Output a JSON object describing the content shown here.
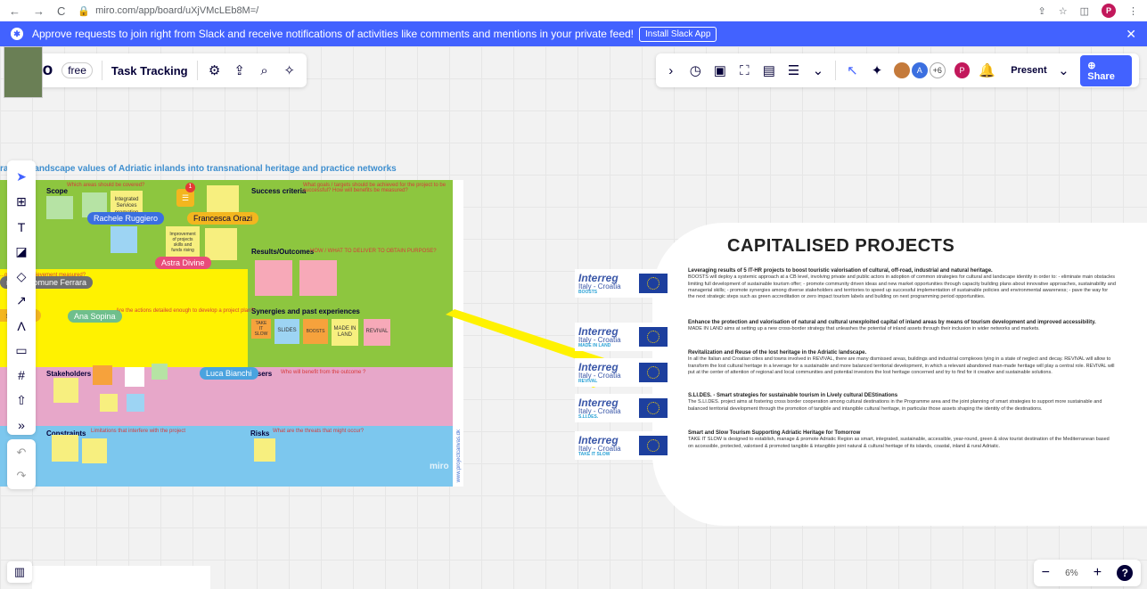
{
  "browser": {
    "back": "←",
    "forward": "→",
    "reload": "C",
    "url": "miro.com/app/board/uXjVMcLEb8M=/",
    "profile_initial": "P"
  },
  "banner": {
    "message": "Approve requests to join right from Slack and receive notifications of activities like comments and mentions in your private feed!",
    "install_label": "Install Slack App",
    "close": "✕"
  },
  "toolbar_left": {
    "logo": "miro",
    "plan": "free",
    "board_name": "Task Tracking"
  },
  "toolbar_right": {
    "extra_count": "+6",
    "present_label": "Present",
    "share_label": "Share",
    "user_initial": "P",
    "avatar_initial": "A"
  },
  "zoom": {
    "minus": "−",
    "level": "6%",
    "plus": "+",
    "help": "?"
  },
  "board": {
    "title": "ral and landscape values of Adriatic inlands into transnational heritage and practice networks",
    "zones": {
      "scope": "Scope",
      "scope_q": "Which areas should be covered?",
      "success": "Success criteria",
      "success_q": "What goals / targets should be achieved for the project to be successful? How will benefits be measured?",
      "results": "Results/Outcomes",
      "results_q": "HOW / WHAT TO DELIVER TO OBTAIN PURPOSE?",
      "achievement_q": "...ow is the achievement measured?",
      "synergies": "Synergies and past experiences",
      "actions_q": "Are the actions detailed enough to develop a project plan?",
      "stakeholders": "Stakeholders",
      "users": "Users",
      "users_q": "Who will benefit from the outcome ?",
      "constraints": "Constraints",
      "constraints_q": "Limitations that interfere with the project",
      "risks": "Risks",
      "risks_q": "What are the threats that might occur?"
    },
    "synergy_notes": [
      "TAKE IT SLOW",
      "SLIDES",
      "BOOSTS",
      "MADE IN LAND",
      "REVIVAL"
    ],
    "scope_notes": [
      "Integrated Services promotion",
      "Improvement of projects skills and funds rising"
    ],
    "cursors": [
      {
        "name": "Rachele Ruggiero",
        "color": "#3b6fe0"
      },
      {
        "name": "Francesca Orazi",
        "color": "#f3b61f"
      },
      {
        "name": "Astra Divine",
        "color": "#e94c7a"
      },
      {
        "name": "rcella Comune Ferrara",
        "color": "#6f6f6f"
      },
      {
        "name": "ssandra",
        "color": "#f3b61f"
      },
      {
        "name": "Ana Sopina",
        "color": "#6fbf8c"
      },
      {
        "name": "Luca Bianchi",
        "color": "#4aa3df"
      }
    ],
    "comment_count": "1",
    "watermark": "miro",
    "side_link": "www.projectcanvas.dk"
  },
  "capitalised": {
    "title": "CAPITALISED PROJECTS",
    "projects": [
      {
        "logo_name": "BOOSTS",
        "heading": "Leveraging results of 5 IT-HR projects to boost touristic valorisation of cultural, off-road, industrial and natural heritage.",
        "body": "BOOSTS will deploy a systemic approach at a CB level, involving private and public actors in adoption of common strategies for cultural and landscape identity in order to: - eliminate main obstacles limiting full development of sustainable tourism offer; - promote community driven ideas and new market opportunities through capacity building plans about innovative approaches, sustainability and managerial skills; - promote synergies among diverse stakeholders and territories to speed up successful implementation of sustainable policies and environmental awareness; - pave the way for the next strategic steps such as green accreditation or zero impact tourism labels and building on next programming period opportunities."
      },
      {
        "logo_name": "MADE IN LAND",
        "heading": "Enhance the protection and valorisation of natural and cultural unexploited capital of inland areas by means of tourism development and improved accessibility.",
        "body": "MADE IN LAND aims at setting up a new cross-border strategy that unleashes the potential of inland assets through their inclusion in wider networks and markets."
      },
      {
        "logo_name": "REVIVAL",
        "heading": "Revitalization and Reuse of the lost heritage in the Adriatic landscape.",
        "body": "In all the Italian and Croatian cities and towns involved in REVIVAL, there are many dismissed areas, buildings and industrial complexes lying in a state of neglect and decay. REVIVAL will allow to transform the lost cultural heritage in a leverage for a sustainable and more balanced territorial development, in which a relevant abandoned man-made heritage will play a central role. REVIVAL will put at the center of attention of regional and local communities and potential investors the lost heritage concerned and try to find for it creative and sustainable solutions."
      },
      {
        "logo_name": "S.LI.DES.",
        "heading": "S.LI.DES. - Smart strategies for sustainable tourism in Lively cultural DEStinations",
        "body": "The S.LI.DES. project aims at fostering cross border cooperation among cultural destinations in the Programme area and the joint planning of smart strategies to support more sustainable and balanced territorial development through the promotion of tangible and intangible cultural heritage, in particular those assets shaping the identity of the destinations."
      },
      {
        "logo_name": "TAKE IT SLOW",
        "heading": "Smart and Slow Tourism Supporting Adriatic Heritage for Tomorrow",
        "body": "TAKE IT SLOW is designed to establish, manage & promote Adriatic Region as smart, integrated, sustainable, accessible, year-round, green & slow tourist destination of the Mediterranean based on accessible, protected, valorised & promoted tangible & intangible joint natural & cultural heritage of its islands, coastal, inland & rural Adriatic."
      }
    ],
    "logo_brand": "Interreg",
    "logo_region": "Italy - Croatia"
  },
  "colors": {
    "accent": "#4262ff",
    "zone_green": "#8dc63f",
    "zone_yellow": "#fff200",
    "zone_pink": "#e7a7c9",
    "zone_blue": "#7cc7ee"
  }
}
